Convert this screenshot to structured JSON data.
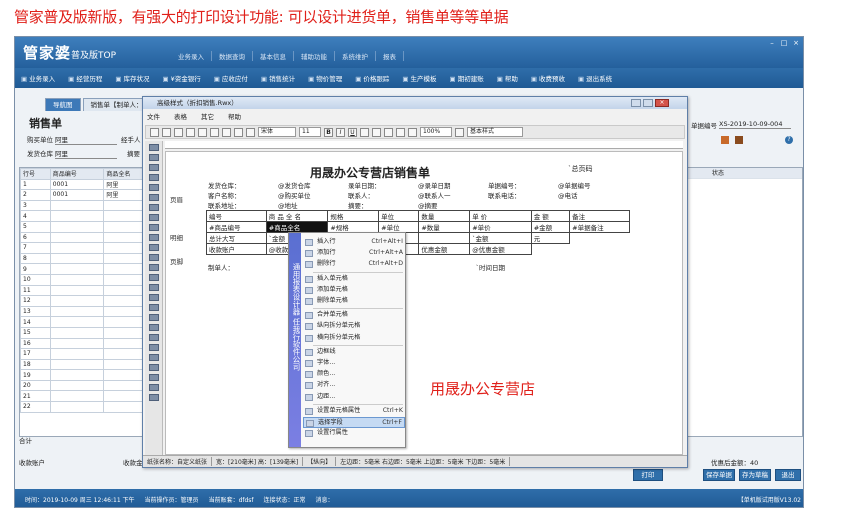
{
  "caption": "管家普及版新版，有强大的打印设计功能: 可以设计进货单，销售单等等单据",
  "app": {
    "logo_main": "管家婆",
    "logo_sub": "普及版TOP",
    "top_menu": [
      "业务录入",
      "数据查询",
      "基本信息",
      "辅助功能",
      "系统维护",
      "报表"
    ],
    "toolbar": [
      {
        "icon": "house-icon",
        "label": "业务录入"
      },
      {
        "icon": "history-icon",
        "label": "经营历程"
      },
      {
        "icon": "stock-icon",
        "label": "库存状况"
      },
      {
        "icon": "bank-icon",
        "label": "¥资金银行"
      },
      {
        "icon": "receivable-icon",
        "label": "应收应付"
      },
      {
        "icon": "sales-icon",
        "label": "销售统计"
      },
      {
        "icon": "goods-icon",
        "label": "物价管理"
      },
      {
        "icon": "price-icon",
        "label": "价格跟踪"
      },
      {
        "icon": "production-icon",
        "label": "生产模板"
      },
      {
        "icon": "account-icon",
        "label": "期初建账"
      },
      {
        "icon": "help-icon",
        "label": "帮助"
      },
      {
        "icon": "money-icon",
        "label": "收费预收"
      },
      {
        "icon": "exit-icon",
        "label": "退出系统"
      }
    ],
    "tabs": [
      "导航图",
      "销售单【制单人："
    ],
    "form_title": "销售单",
    "buyer_label": "购买单位",
    "buyer_value": "阿里",
    "handler_label": "经手人",
    "warehouse_label": "发货仓库",
    "warehouse_value": "阿里",
    "summary_label": "摘要",
    "doc_no_label": "单据编号",
    "doc_no_value": "XS-2019-10-09-004",
    "grid_headers": [
      "行号",
      "商品编号",
      "商品全名"
    ],
    "grid_rows": [
      [
        "1",
        "0001",
        "阿里"
      ],
      [
        "2",
        "0001",
        "阿里"
      ],
      [
        "3",
        "",
        ""
      ],
      [
        "4",
        "",
        ""
      ],
      [
        "5",
        "",
        ""
      ],
      [
        "6",
        "",
        ""
      ],
      [
        "7",
        "",
        ""
      ],
      [
        "8",
        "",
        ""
      ],
      [
        "9",
        "",
        ""
      ],
      [
        "10",
        "",
        ""
      ],
      [
        "11",
        "",
        ""
      ],
      [
        "12",
        "",
        ""
      ],
      [
        "13",
        "",
        ""
      ],
      [
        "14",
        "",
        ""
      ],
      [
        "15",
        "",
        ""
      ],
      [
        "16",
        "",
        ""
      ],
      [
        "17",
        "",
        ""
      ],
      [
        "18",
        "",
        ""
      ],
      [
        "19",
        "",
        ""
      ],
      [
        "20",
        "",
        ""
      ],
      [
        "21",
        "",
        ""
      ],
      [
        "22",
        "",
        ""
      ]
    ],
    "grid_total_label": "合计",
    "right_col_header": "状态",
    "collect_account_label": "收款账户",
    "collect_amount_label": "收款金",
    "after_discount_label": "优惠后金额：",
    "after_discount_value": "40",
    "buttons": [
      "打印",
      "保存单据",
      "存为草稿",
      "退出"
    ],
    "status": [
      "时间：2019-10-09 周三 12:46:11 下午",
      "当前操作员：管理员",
      "当前账套：dfdsf",
      "连接状态：正常",
      "消息："
    ],
    "version": "【单机版试用版V13.02"
  },
  "dialog": {
    "title": "高级样式（折扣销售.Rwx）",
    "menu": [
      "文件",
      "表格",
      "其它",
      "帮助"
    ],
    "font_name": "宋体",
    "font_size": "11",
    "zoom": "100%",
    "style_name": "基本样式",
    "bands": [
      "页眉",
      "明细",
      "页脚"
    ],
    "report": {
      "title": "用晟办公专营店销售单",
      "pages_label": "总页码",
      "header_rows": [
        [
          "发货仓库：",
          "@发货仓库",
          "录单日期：",
          "@录单日期",
          "单据编号：",
          "@单据编号"
        ],
        [
          "客户名称：",
          "@购买单位",
          "联系人：",
          "@联系人一",
          "联系电话：",
          "@电话"
        ],
        [
          "联系地址：",
          "@地址",
          "摘要：",
          "@摘要",
          "",
          ""
        ]
      ],
      "col_headers": [
        "编号",
        "商 品 全 名",
        "规格",
        "单位",
        "数量",
        "单 价",
        "金 额",
        "备注"
      ],
      "detail_row": [
        "#商品编号",
        "#商品全名",
        "#规格",
        "#单位",
        "#数量",
        "#单价",
        "#金额",
        "#单据备注"
      ],
      "total_row": [
        "总计大写",
        "`金额",
        "`数量",
        "丙小计",
        "",
        "`金额",
        "元"
      ],
      "payment_row": [
        "收款账户",
        "@收款账户",
        "收款金额",
        "元",
        "优惠金额",
        "@优惠金额"
      ],
      "footer_row": [
        "制单人：",
        "@制单人",
        "打印日期：",
        "`时间日期"
      ]
    },
    "status": [
      "纸张名称：自定义纸张",
      "宽：[210毫米] 高：[139毫米]",
      "【纵向】",
      "左边距：5毫米 右边距：5毫米 上边距：5毫米 下边距：5毫米"
    ]
  },
  "context_menu": {
    "side_text": "通用报表设计器  任我行软件公司",
    "items": [
      {
        "label": "插入行",
        "key": "Ctrl+Alt+I"
      },
      {
        "label": "添加行",
        "key": "Ctrl+Alt+A"
      },
      {
        "label": "删除行",
        "key": "Ctrl+Alt+D"
      },
      {
        "label": "插入单元格",
        "key": ""
      },
      {
        "label": "添加单元格",
        "key": ""
      },
      {
        "label": "删除单元格",
        "key": ""
      },
      {
        "label": "合并单元格",
        "key": ""
      },
      {
        "label": "纵向拆分单元格",
        "key": ""
      },
      {
        "label": "横向拆分单元格",
        "key": ""
      },
      {
        "label": "边框线",
        "key": ""
      },
      {
        "label": "字体...",
        "key": ""
      },
      {
        "label": "颜色...",
        "key": ""
      },
      {
        "label": "对齐...",
        "key": ""
      },
      {
        "label": "边距...",
        "key": ""
      },
      {
        "label": "设置单元格属性",
        "key": "Ctrl+K"
      },
      {
        "label": "选择字段",
        "key": "Ctrl+F"
      },
      {
        "label": "设置行属性",
        "key": ""
      }
    ],
    "selected_index": 15
  },
  "shop_name": "用晟办公专营店"
}
